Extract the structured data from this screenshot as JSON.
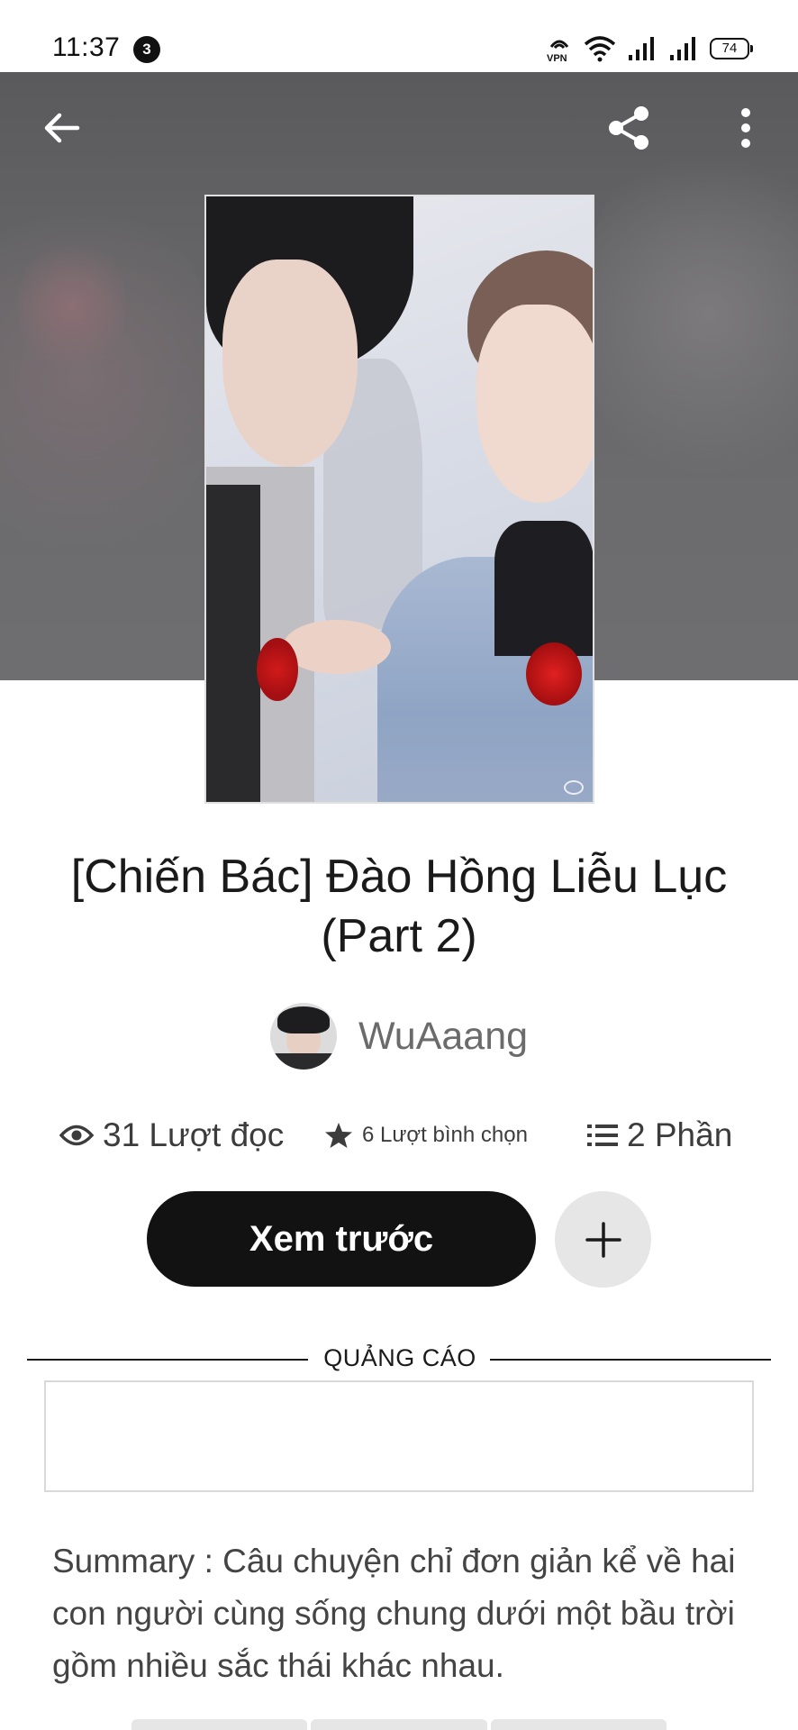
{
  "status_bar": {
    "time": "11:37",
    "notification_count": "3",
    "battery": "74",
    "icons": [
      "vpn-icon",
      "wifi-icon",
      "signal-icon",
      "signal-icon",
      "battery-icon"
    ]
  },
  "header": {
    "icons": [
      "back-arrow-icon",
      "share-icon",
      "more-vertical-icon"
    ]
  },
  "story": {
    "title": "[Chiến Bác] Đào Hồng Liễu Lục (Part 2)",
    "author": "WuAaang",
    "stats": {
      "reads": "31 Lượt đọc",
      "votes": "6 Lượt bình chọn",
      "parts": "2 Phần"
    },
    "summary": "Summary : Câu chuyện chỉ đơn giản kể về hai con người cùng sống chung dưới một bầu trời gồm nhiều sắc thái khác nhau."
  },
  "actions": {
    "preview_label": "Xem trước",
    "add_icon": "plus-icon"
  },
  "ad": {
    "label": "QUẢNG CÁO"
  },
  "colors": {
    "primary_button": "#121212",
    "secondary_button": "#e6e6e6",
    "header_bg": "#646466"
  }
}
